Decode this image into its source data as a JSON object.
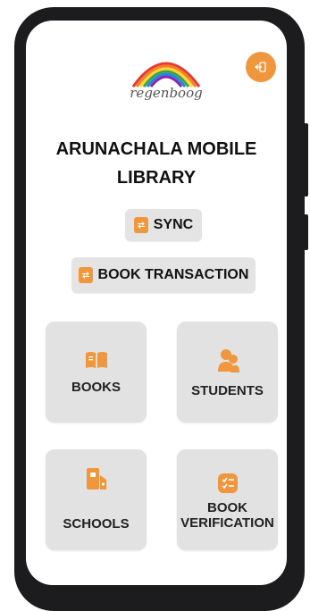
{
  "app": {
    "logo_text": "regenboog",
    "logo_subtitle": "",
    "title_line1": "ARUNACHALA MOBILE",
    "title_line2": "LIBRARY"
  },
  "actions": {
    "sync_label": "SYNC",
    "transaction_label": "BOOK TRANSACTION"
  },
  "tiles": {
    "books": "BOOKS",
    "students": "STUDENTS",
    "schools": "SCHOOLS",
    "verification_line1": "BOOK",
    "verification_line2": "VERIFICATION"
  },
  "icons": {
    "logout": "logout-icon",
    "sync": "sync-icon",
    "transaction": "transaction-icon",
    "books": "book-open-icon",
    "students": "users-icon",
    "schools": "school-icon",
    "verification": "checklist-icon"
  },
  "colors": {
    "accent": "#f0963c",
    "tile_bg": "#e2e2e2",
    "text": "#111111"
  }
}
